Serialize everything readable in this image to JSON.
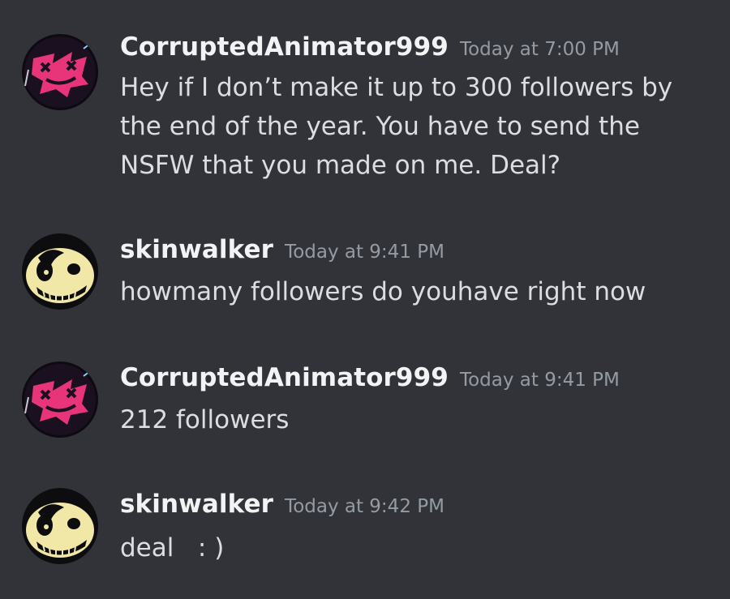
{
  "messages": [
    {
      "username": "CorruptedAnimator999",
      "timestamp": "Today at 7:00 PM",
      "content": "Hey if I don’t make it up to 300 followers by the end of the year. You have to send the NSFW that you made on me. Deal?",
      "avatar_icon": "corrupted-animator-avatar-icon"
    },
    {
      "username": "skinwalker",
      "timestamp": "Today at 9:41 PM",
      "content": "howmany followers do youhave right now",
      "avatar_icon": "skinwalker-avatar-icon"
    },
    {
      "username": "CorruptedAnimator999",
      "timestamp": "Today at 9:41 PM",
      "content": "212 followers",
      "avatar_icon": "corrupted-animator-avatar-icon"
    },
    {
      "username": "skinwalker",
      "timestamp": "Today at 9:42 PM",
      "content": "deal   : )",
      "avatar_icon": "skinwalker-avatar-icon"
    }
  ],
  "colors": {
    "background": "#313338",
    "username": "#f2f3f5",
    "timestamp": "#949ba4",
    "text": "#dbdee1"
  }
}
